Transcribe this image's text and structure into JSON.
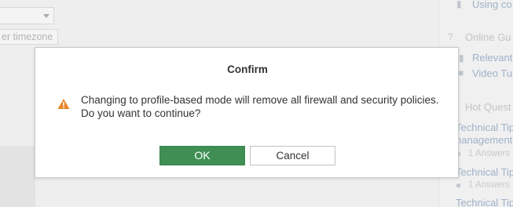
{
  "background": {
    "timezone_button_label": "er timezone",
    "sidebar": {
      "using_link": "Using co",
      "online_guides_heading": "Online Gu",
      "relevant_link": "Relevant",
      "video_link": "Video Tu",
      "hot_questions_heading": "Hot Quest",
      "questions": [
        {
          "title_line1": "Technical Tip",
          "title_line2": "nanagement",
          "answers": "1 Answers"
        },
        {
          "title_line1": "Technical Tip",
          "answers": "1 Answers"
        },
        {
          "title_line1": "Technical Tip"
        }
      ]
    }
  },
  "dialog": {
    "title": "Confirm",
    "icon": "warning-triangle-icon",
    "message_line1": "Changing to profile-based mode will remove all firewall and security policies.",
    "message_line2": "Do you want to continue?",
    "ok_label": "OK",
    "cancel_label": "Cancel"
  },
  "colors": {
    "ok_button": "#3f8f55",
    "warning_icon": "#e8862a"
  }
}
